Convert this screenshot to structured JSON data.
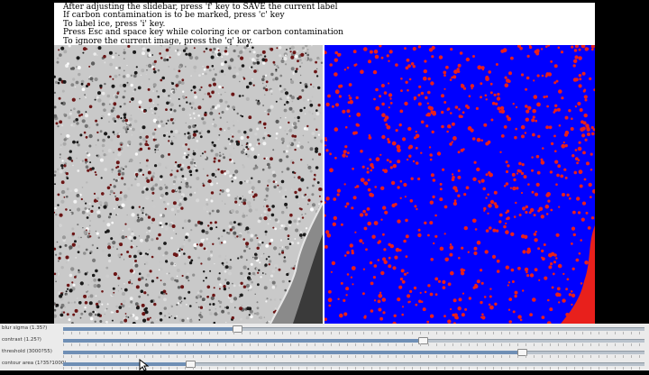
{
  "instructions": {
    "lines": [
      "After adjusting the slidebar, press 'f' key to SAVE the current label",
      "If carbon contamination is to be marked, press 'c' key",
      "To label ice, press 'i' key.",
      "Press Esc and space key while coloring ice or carbon contamination",
      "To ignore the current image, press the 'q' key."
    ]
  },
  "colors": {
    "label_background": "#0000ff",
    "label_particle": "#e8201c",
    "micrograph_dark_spot": "#6b1515",
    "slider_fill": "#6f8fb5"
  },
  "sliders": [
    {
      "label": "blur sigma (1.35?)",
      "value_fraction": 0.3
    },
    {
      "label": "contrast (1.25?)",
      "value_fraction": 0.62
    },
    {
      "label": "threshold (3000?55)",
      "value_fraction": 0.79
    },
    {
      "label": "contour area (1?35?1000)",
      "value_fraction": 0.22
    }
  ],
  "icons": {
    "cursor": "mouse-pointer-icon"
  }
}
